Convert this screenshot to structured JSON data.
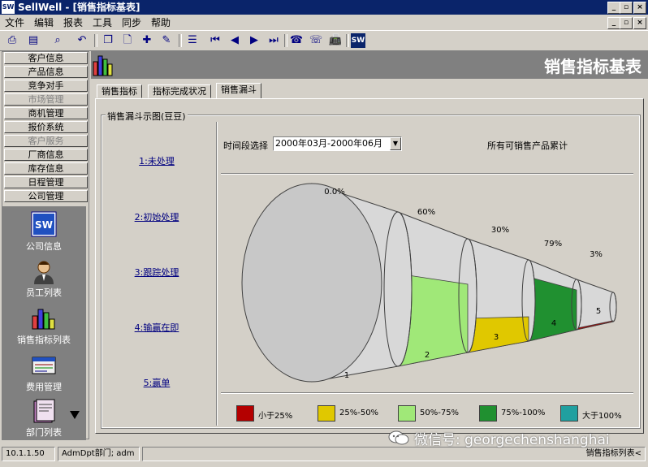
{
  "window": {
    "title": "SellWell - [销售指标基表]",
    "app_icon": "SW",
    "controls": {
      "minimize": "_",
      "restore": "▫",
      "close": "×"
    },
    "mdi_controls": {
      "minimize": "_",
      "restore": "▫",
      "close": "×"
    }
  },
  "menu": [
    "文件",
    "编辑",
    "报表",
    "工具",
    "同步",
    "帮助"
  ],
  "toolbar_icons": [
    "print-icon",
    "print-preview-icon",
    "find-icon",
    "undo-icon",
    "copy-icon",
    "new-icon",
    "add-icon",
    "edit-icon",
    "list-icon",
    "first-record-icon",
    "prev-record-icon",
    "next-record-icon",
    "last-record-icon",
    "phone-icon",
    "phone2-icon",
    "fax-icon",
    "sellwell-icon"
  ],
  "sidebar": {
    "items": [
      {
        "label": "客户信息",
        "enabled": true
      },
      {
        "label": "产品信息",
        "enabled": true
      },
      {
        "label": "竞争对手",
        "enabled": true
      },
      {
        "label": "市场管理",
        "enabled": false
      },
      {
        "label": "商机管理",
        "enabled": true
      },
      {
        "label": "报价系统",
        "enabled": true
      },
      {
        "label": "客户服务",
        "enabled": false
      },
      {
        "label": "厂商信息",
        "enabled": true
      },
      {
        "label": "库存信息",
        "enabled": true
      },
      {
        "label": "日程管理",
        "enabled": true
      },
      {
        "label": "公司管理",
        "enabled": true
      }
    ],
    "panel": [
      {
        "label": "公司信息",
        "icon": "company-info-icon",
        "glyph": "SW"
      },
      {
        "label": "员工列表",
        "icon": "employee-icon"
      },
      {
        "label": "销售指标列表",
        "icon": "sales-chart-icon"
      },
      {
        "label": "费用管理",
        "icon": "expense-icon"
      },
      {
        "label": "部门列表",
        "icon": "department-icon"
      }
    ]
  },
  "header": {
    "title": "销售指标基表"
  },
  "tabs": [
    {
      "label": "销售指标",
      "active": false
    },
    {
      "label": "指标完成状况",
      "active": false
    },
    {
      "label": "销售漏斗",
      "active": true
    }
  ],
  "funnel": {
    "group_label": "销售漏斗示图(豆豆)",
    "stages": [
      "1:未处理",
      "2:初始处理",
      "3:跟踪处理",
      "4:输赢在即",
      "5:赢单"
    ],
    "period_label": "时间段选择",
    "period_value": "2000年03月-2000年06月",
    "scope_label": "所有可销售产品累计",
    "colors": {
      "lt25": "#b40000",
      "p25_50": "#e0c800",
      "p50_75": "#a0e878",
      "p75_100": "#209030",
      "gt100": "#20a0a0",
      "empty": "#d8d8d8"
    }
  },
  "chart_data": {
    "type": "funnel",
    "categories": [
      "1",
      "2",
      "3",
      "4",
      "5"
    ],
    "percent_labels": [
      "0.0%",
      "60%",
      "30%",
      "79%",
      "3%"
    ],
    "values": [
      0.0,
      60,
      30,
      79,
      3
    ],
    "color_bands": [
      "50%-75%",
      "25%-50%",
      "75%-100%",
      "小于25%"
    ],
    "legend": [
      {
        "label": "小于25%",
        "color": "#b40000"
      },
      {
        "label": "25%-50%",
        "color": "#e0c800"
      },
      {
        "label": "50%-75%",
        "color": "#a0e878"
      },
      {
        "label": "75%-100%",
        "color": "#209030"
      },
      {
        "label": "大于100%",
        "color": "#20a0a0"
      }
    ]
  },
  "status": {
    "ip": "10.1.1.50",
    "user": "AdmDpt部门; adm",
    "current": "销售指标列表<"
  },
  "watermark": "微信号: georgechenshanghai"
}
